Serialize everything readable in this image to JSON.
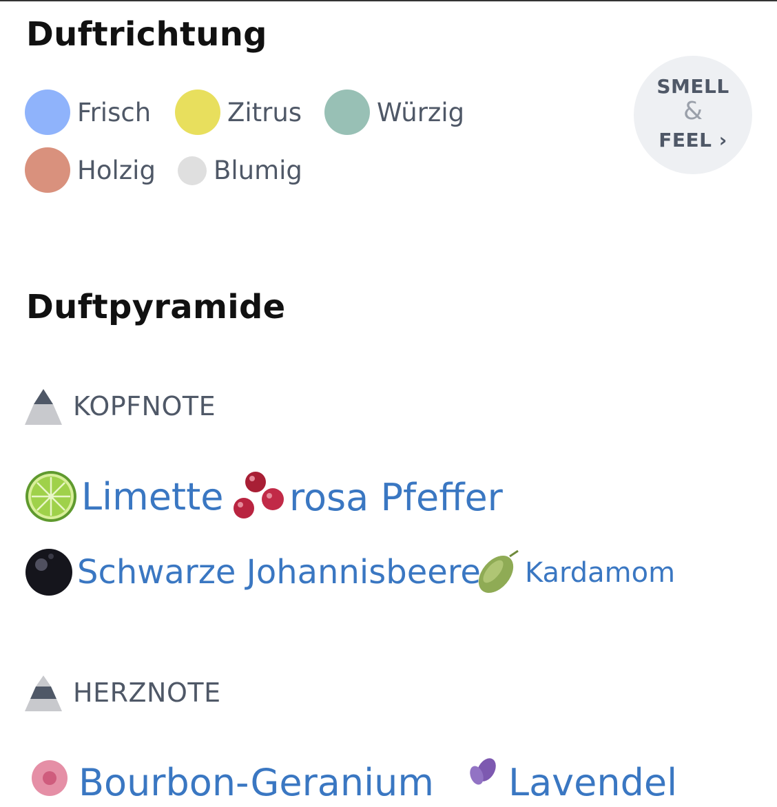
{
  "colors": {
    "frisch": "#8fb3fb",
    "zitrus": "#e8df5d",
    "wuerzig": "#98c0b5",
    "holzig": "#d9917d",
    "blumig": "#dfdfdf",
    "link": "#3a77c2",
    "text_muted": "#4f5867"
  },
  "sections": {
    "duftrichtung_title": "Duftrichtung",
    "duftpyramide_title": "Duftpyramide"
  },
  "families": [
    {
      "label": "Frisch",
      "color": "#8fb3fb"
    },
    {
      "label": "Zitrus",
      "color": "#e8df5d"
    },
    {
      "label": "Würzig",
      "color": "#98c0b5"
    },
    {
      "label": "Holzig",
      "color": "#d9917d"
    },
    {
      "label": "Blumig",
      "color": "#dfdfdf"
    }
  ],
  "smell_feel": {
    "line1": "SMELL",
    "amp": "&",
    "line2": "FEEL",
    "chevron": "›"
  },
  "kopfnote": {
    "label": "KOPFNOTE",
    "icon": "pyramid-top-icon",
    "ingredients": [
      {
        "label": "Limette",
        "icon": "lime-icon"
      },
      {
        "label": "rosa Pfeffer",
        "icon": "pink-pepper-icon"
      },
      {
        "label": "Schwarze Johannisbeere",
        "icon": "blackcurrant-icon"
      },
      {
        "label": "Kardamom",
        "icon": "cardamom-icon"
      }
    ]
  },
  "herznote": {
    "label": "HERZNOTE",
    "icon": "pyramid-middle-icon",
    "ingredients": [
      {
        "label": "Bourbon-Geranium",
        "icon": "geranium-icon"
      },
      {
        "label": "Lavendel",
        "icon": "lavender-icon"
      }
    ]
  }
}
